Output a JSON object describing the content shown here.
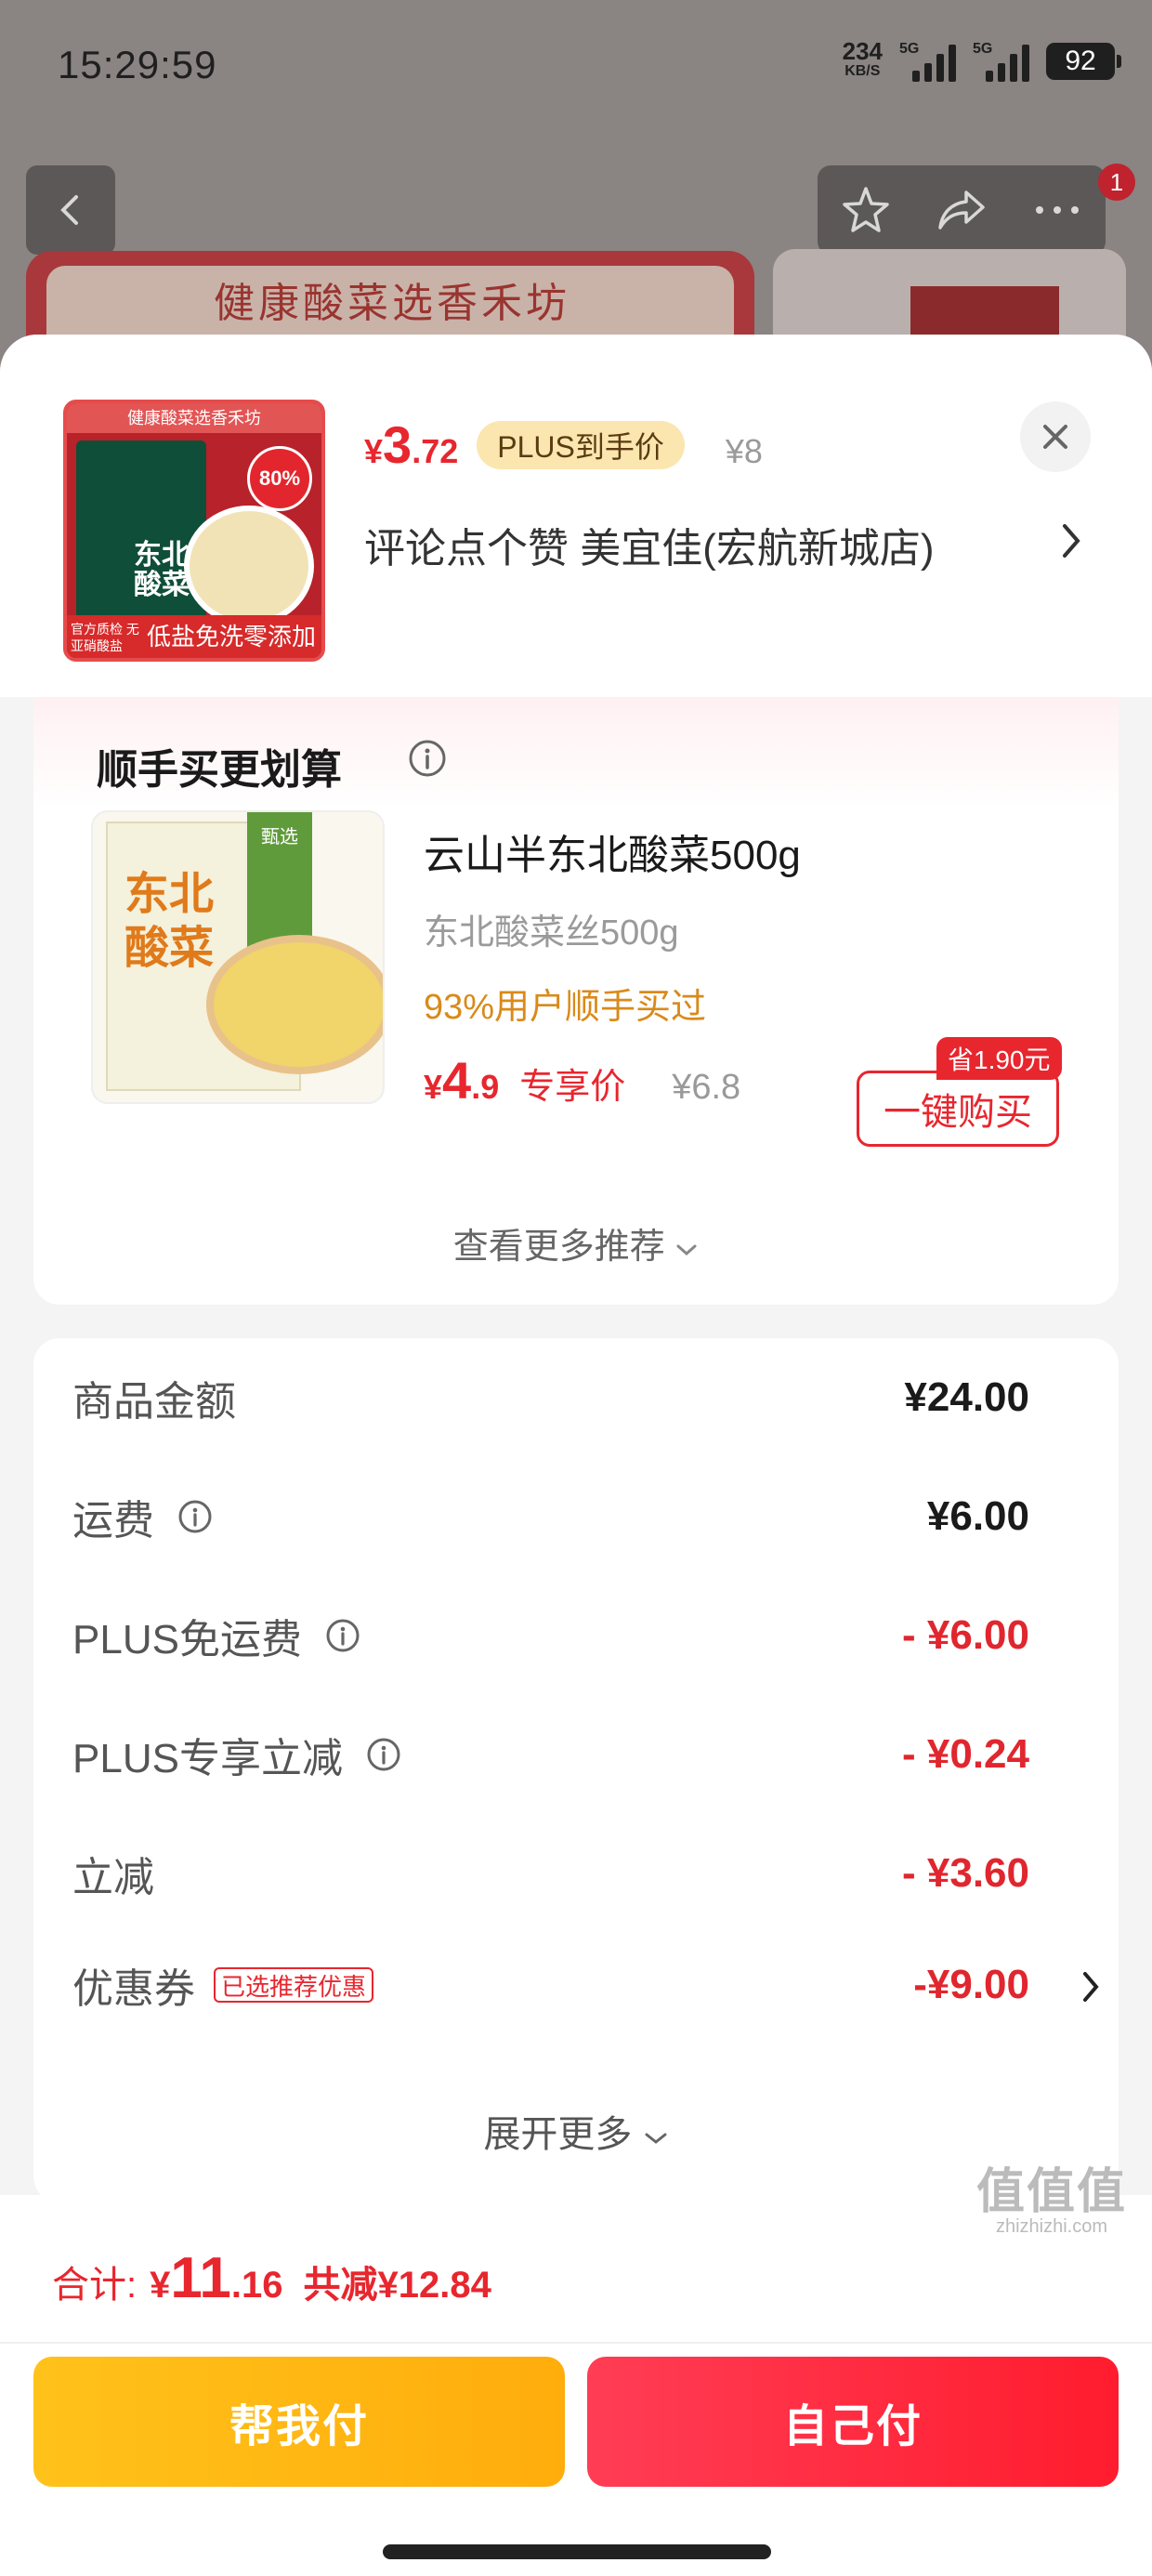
{
  "status_bar": {
    "time": "15:29:59",
    "net_speed": "234",
    "net_unit": "KB/S",
    "signal1": "5G",
    "signal2": "5G",
    "battery": "92"
  },
  "background_page": {
    "banner_text": "健康酸菜选香禾坊",
    "cart_badge": "1"
  },
  "product": {
    "image_tagline": "健康酸菜选香禾坊",
    "image_title": "东北酸菜",
    "image_badge": "80%",
    "image_footer_left": "官方质检 无亚硝酸盐",
    "image_footer_right": "低盐免洗零添加",
    "price_currency": "¥",
    "price_int": "3",
    "price_dec": ".72",
    "plus_label": "PLUS到手价",
    "original_price": "¥8",
    "store_line": "评论点个赞  美宜佳(宏航新城店)"
  },
  "recommend": {
    "title": "顺手买更划算",
    "item": {
      "name": "云山半东北酸菜500g",
      "sub": "东北酸菜丝500g",
      "bought": "93%用户顺手买过",
      "price_currency": "¥",
      "price_int": "4",
      "price_dec": ".9",
      "price_tag": "专享价",
      "original_price": "¥6.8",
      "save_badge": "省1.90元",
      "buy_button": "一键购买",
      "image_title": "东北酸菜",
      "image_green": "甄选"
    },
    "more_label": "查看更多推荐"
  },
  "breakdown": {
    "rows": [
      {
        "label": "商品金额",
        "value": "¥24.00"
      },
      {
        "label": "运费",
        "value": "¥6.00"
      },
      {
        "label": "PLUS免运费",
        "value": "- ¥6.00"
      },
      {
        "label": "PLUS专享立减",
        "value": "- ¥0.24"
      },
      {
        "label": "立减",
        "value": "- ¥3.60"
      },
      {
        "label": "优惠券",
        "value": "-¥9.00",
        "tag": "已选推荐优惠"
      }
    ],
    "expand_label": "展开更多"
  },
  "footer": {
    "total_label": "合计:",
    "total_currency": "¥",
    "total_int": "11",
    "total_dec": ".16",
    "saved_label": "共减¥12.84",
    "pay_friend": "帮我付",
    "pay_self": "自己付"
  },
  "watermark": {
    "big": "值值值",
    "small": "zhizhizhi.com"
  },
  "colors": {
    "accent_red": "#e8262e",
    "plus_gold": "#fbe6b0",
    "pay_friend_yellow": "#ffb912",
    "pay_self_red": "#ff2a40"
  },
  "icons": [
    "back-icon",
    "star-icon",
    "share-icon",
    "more-icon",
    "close-icon",
    "chevron-right-icon",
    "info-icon",
    "chevron-down-icon"
  ]
}
